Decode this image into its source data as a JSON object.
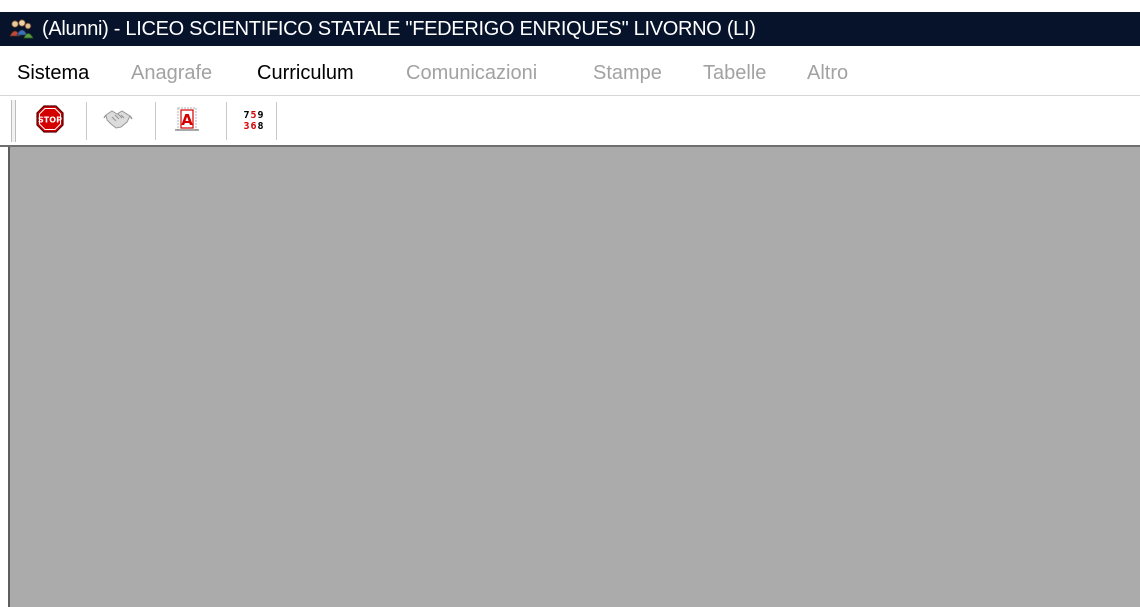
{
  "window": {
    "title": "(Alunni) - LICEO SCIENTIFICO STATALE \"FEDERIGO ENRIQUES\" LIVORNO (LI)",
    "icon": "app-people-icon"
  },
  "menu": {
    "items": [
      {
        "label": "Sistema",
        "enabled": true
      },
      {
        "label": "Anagrafe",
        "enabled": false
      },
      {
        "label": "Curriculum",
        "enabled": true
      },
      {
        "label": "Comunicazioni",
        "enabled": false
      },
      {
        "label": "Stampe",
        "enabled": false
      },
      {
        "label": "Tabelle",
        "enabled": false
      },
      {
        "label": "Altro",
        "enabled": false
      }
    ]
  },
  "toolbar": {
    "buttons": [
      {
        "icon": "stop-icon",
        "label": "STOP",
        "enabled": true
      },
      {
        "icon": "handshake-icon",
        "enabled": false
      },
      {
        "icon": "text-frame-icon",
        "label": "A",
        "enabled": true
      },
      {
        "icon": "number-grid-icon",
        "row1": [
          "7",
          "5",
          "9"
        ],
        "row2": [
          "3",
          "6",
          "8"
        ],
        "enabled": true
      }
    ]
  },
  "colors": {
    "titlebar": "#07132b",
    "client_area": "#ababab",
    "menu_disabled": "#a2a2a2",
    "stop_red": "#d40000"
  }
}
